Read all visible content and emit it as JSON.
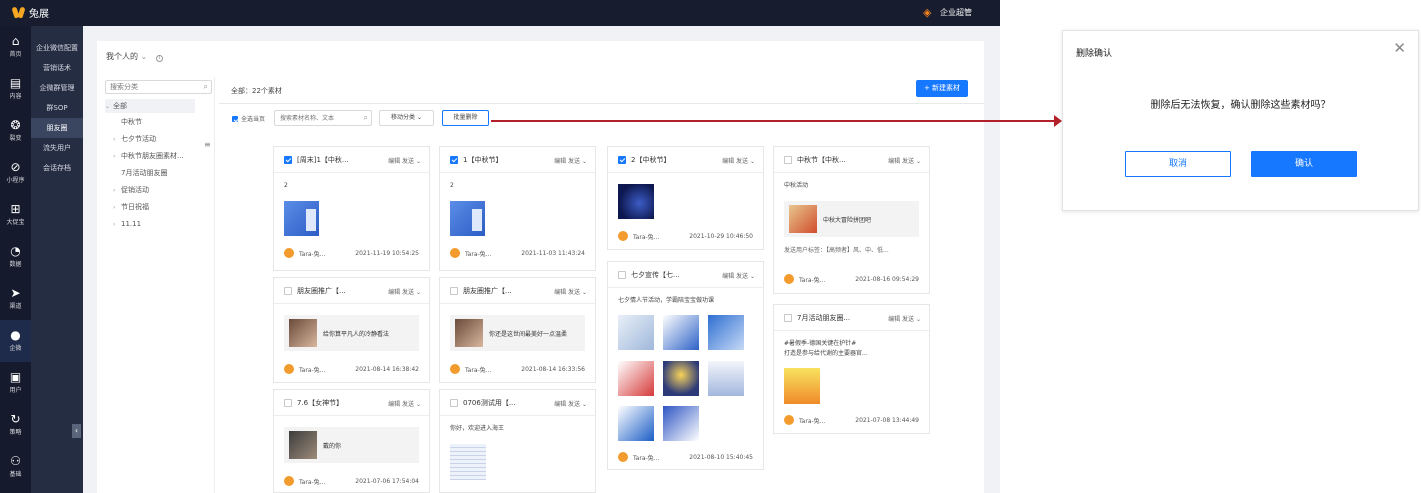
{
  "app": {
    "logo_text": "兔展",
    "corp_label": "企业超管",
    "colors": {
      "accent": "#1677ff",
      "sidebar": "#151b2c",
      "arrow": "#b3202a",
      "avatar": "#f39b2c"
    }
  },
  "nav": {
    "items": [
      {
        "label": "首页",
        "icon": "home-icon"
      },
      {
        "label": "内容",
        "icon": "document-icon"
      },
      {
        "label": "裂变",
        "icon": "bulldog-icon"
      },
      {
        "label": "小程序",
        "icon": "compass-icon"
      },
      {
        "label": "大促宝",
        "icon": "gift-icon"
      },
      {
        "label": "数据",
        "icon": "pie-icon"
      },
      {
        "label": "渠道",
        "icon": "send-icon"
      },
      {
        "label": "企微",
        "icon": "chat-icon"
      },
      {
        "label": "用户",
        "icon": "user-list-icon"
      },
      {
        "label": "策略",
        "icon": "sync-icon"
      },
      {
        "label": "基础",
        "icon": "person-gear-icon"
      }
    ],
    "active_index": 7
  },
  "subnav": {
    "items": [
      "企业微信配置",
      "营销话术",
      "企微群管理",
      "群SOP",
      "朋友圈",
      "流失用户",
      "会话存档"
    ],
    "active_index": 4
  },
  "breadcrumb": {
    "scope": "我个人的"
  },
  "tree": {
    "search_placeholder": "搜索分类",
    "nodes": [
      "全部",
      "中秋节",
      "七夕节活动",
      "中秋节朋友圈素材...",
      "7月活动朋友圈",
      "促销活动",
      "节日祝福",
      "11.11"
    ]
  },
  "content": {
    "total": "全部：22个素材",
    "new_button": "+ 新建素材",
    "select_all": "全选当页",
    "search_placeholder": "搜索素材名称、文本",
    "move_button": "移动分类",
    "bulk_delete": "批量删除"
  },
  "cards": [
    {
      "title": "[周末]1【中秋...",
      "actions": "编辑 发送",
      "checked": true,
      "text": "2",
      "author": "Tara-兔...",
      "time": "2021-11-19 10:54:25"
    },
    {
      "title": "1【中秋节】",
      "actions": "编辑 发送",
      "checked": true,
      "text": "2",
      "author": "Tara-兔...",
      "time": "2021-11-03 11:43:24"
    },
    {
      "title": "2【中秋节】",
      "actions": "编辑 发送",
      "checked": true,
      "author": "Tara-兔...",
      "time": "2021-10-29 10:46:50"
    },
    {
      "title": "中秋节【中秋...",
      "actions": "编辑 发送",
      "checked": false,
      "text": "中秋活动",
      "link": "中秋大冒险拼团吧",
      "caption": "发送用户标签：【高频者】风、中、低...",
      "author": "Tara-兔...",
      "time": "2021-08-16 09:54:29"
    },
    {
      "title": "朋友圈推广【...",
      "actions": "编辑 发送",
      "checked": false,
      "link": "给你算平凡人的冷静看法",
      "author": "Tara-兔...",
      "time": "2021-08-14 16:38:42"
    },
    {
      "title": "朋友圈推广【...",
      "actions": "编辑 发送",
      "checked": false,
      "link": "你还是这世间最美好一点温柔",
      "author": "Tara-兔...",
      "time": "2021-08-14 16:33:56"
    },
    {
      "title": "七夕宣传【七...",
      "actions": "编辑 发送",
      "checked": false,
      "text": "七夕情人节活动，学霸陪宝宝做功课",
      "author": "Tara-兔...",
      "time": "2021-08-10 15:40:45"
    },
    {
      "title": "7月活动朋友圈...",
      "actions": "编辑 发送",
      "checked": false,
      "text": "#暑假季-德国关键在护针#",
      "text2": "打造是参与给代谢的主要器官...",
      "author": "Tara-兔...",
      "time": "2021-07-08 13:44:49"
    },
    {
      "title": "7.6【女神节】",
      "actions": "编辑 发送",
      "checked": false,
      "link": "戴的你",
      "author": "Tara-兔...",
      "time": "2021-07-06 17:54:04"
    },
    {
      "title": "0706测试用【...",
      "actions": "编辑 发送",
      "checked": false,
      "text": "你好，欢迎进入海王"
    }
  ],
  "dialog": {
    "title": "删除确认",
    "message": "删除后无法恢复，确认删除这些素材吗？",
    "cancel": "取消",
    "confirm": "确认"
  }
}
